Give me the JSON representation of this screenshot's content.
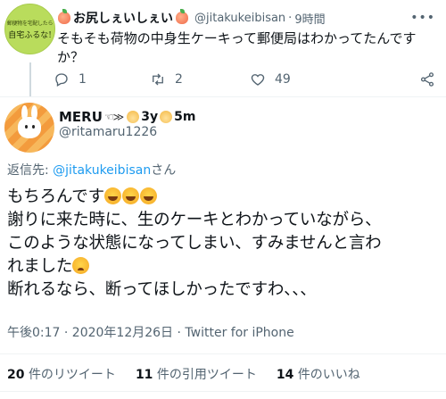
{
  "parent_tweet": {
    "avatar_text_line1": "郵便物を宅配したら",
    "avatar_text_line2": "自宅ふるな!",
    "display_name": "お尻しぇいしぇい",
    "handle": "@jitakukeibisan",
    "separator": "·",
    "time": "9時間",
    "text": "そもそも荷物の中身生ケーキって郵便局はわかってたんですか？",
    "reply_count": "1",
    "retweet_count": "2",
    "like_count": "49",
    "menu_icon": "more-dots-icon"
  },
  "main_tweet": {
    "display_name": "MERU",
    "name_deco": "☜≫",
    "age1": "3y",
    "age2": "5m",
    "handle": "@ritamaru1226",
    "reply_to_prefix": "返信先: ",
    "reply_to_handle": "@jitakukeibisan",
    "reply_to_suffix": "さん",
    "lines": [
      "もちろんです",
      "謝りに来た時に、生のケーキとわかっていながら、",
      "このような状態になってしまい、すみませんと言わ",
      "れました",
      "断れるなら、断ってほしかったですわ、、、"
    ],
    "meta": "午後0:17 · 2020年12月26日 · Twitter for iPhone",
    "stats": {
      "retweets_num": "20",
      "retweets_label": "件のリツイート",
      "quotes_num": "11",
      "quotes_label": "件の引用ツイート",
      "likes_num": "14",
      "likes_label": "件のいいね"
    }
  },
  "colors": {
    "text": "#0f1419",
    "secondary": "#536471",
    "link": "#1d9bf0",
    "divider": "#eff3f4"
  }
}
